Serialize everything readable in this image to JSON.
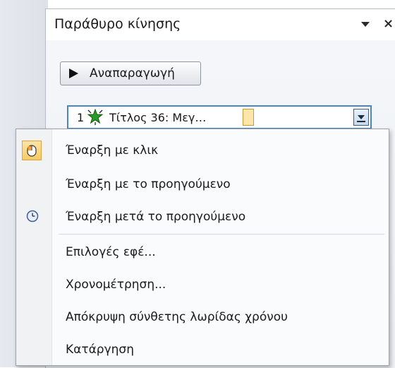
{
  "pane": {
    "title": "Παράθυρο κίνησης",
    "close_symbol": "×",
    "play_button_label": "Αναπαραγωγή"
  },
  "animation_item": {
    "index": "1",
    "title": "Τίτλος 36: Μεγ…",
    "effect_icon": "green-star-icon"
  },
  "context_menu": {
    "items": [
      {
        "text": "Έναρξη με κλικ",
        "icon": "mouse-icon",
        "checked": true
      },
      {
        "text": "Έναρξη με το προηγούμενο",
        "icon": "",
        "checked": false
      },
      {
        "text": "Έναρξη μετά το προηγούμενο",
        "icon": "clock-icon",
        "checked": false
      },
      {
        "text": "Επιλογές εφέ...",
        "icon": "",
        "checked": false
      },
      {
        "text": "Χρονομέτρηση...",
        "icon": "",
        "checked": false
      },
      {
        "text": "Απόκρυψη σύνθετης λωρίδας χρόνου",
        "icon": "",
        "checked": false
      },
      {
        "text": "Κατάργηση",
        "icon": "",
        "checked": false
      }
    ]
  },
  "colors": {
    "selection_border": "#4a85c8",
    "check_highlight": "#f9c964",
    "star": "#2a9a2a"
  }
}
